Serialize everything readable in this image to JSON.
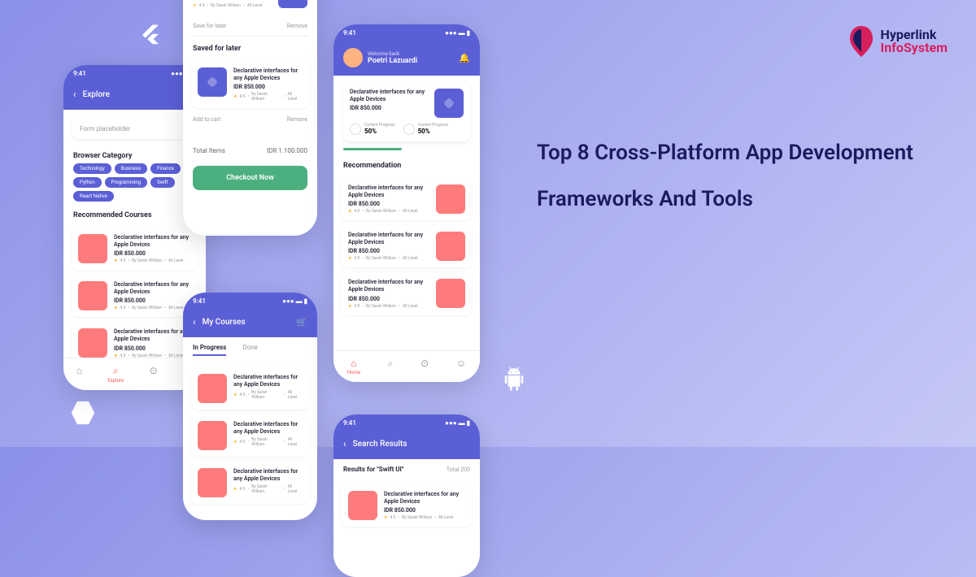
{
  "headline": "Top 8 Cross-Platform App Development Frameworks And Tools",
  "brand": {
    "line1": "Hyperlink",
    "line2": "InfoSystem"
  },
  "common": {
    "time": "9:41",
    "course_title": "Declarative interfaces for any Apple Devices",
    "price": "IDR 850.000",
    "rating": "4.5",
    "author_meta": "By Sarah William",
    "level": "All Level"
  },
  "phone1": {
    "header_title": "Explore",
    "search_placeholder": "Form placeholder",
    "category_title": "Browser Category",
    "chips": [
      "Technology",
      "Business",
      "Finance",
      "Python",
      "Programming",
      "Swift",
      "React Native"
    ],
    "rec_title": "Recommended Courses",
    "nav": [
      "Home",
      "Explore",
      "Courses",
      "Account"
    ]
  },
  "phone2": {
    "save_later": "Save for later",
    "remove": "Remove",
    "saved_title": "Saved for later",
    "add_cart": "Add to cart",
    "total_label": "Total Items",
    "total_value": "IDR 1.100.000",
    "checkout": "Checkout Now"
  },
  "phone3": {
    "header_title": "My Courses",
    "tab1": "In Progress",
    "tab2": "Done"
  },
  "phone4": {
    "welcome": "Welcome back",
    "username": "Poetri Lazuardi",
    "progress_label": "Current Progress",
    "progress_value": "50%",
    "rec_title": "Recommendation",
    "nav_home": "Home"
  },
  "phone5": {
    "header_title": "Search Results",
    "results_label": "Results for \"Swift UI\"",
    "results_count": "Total 200"
  }
}
